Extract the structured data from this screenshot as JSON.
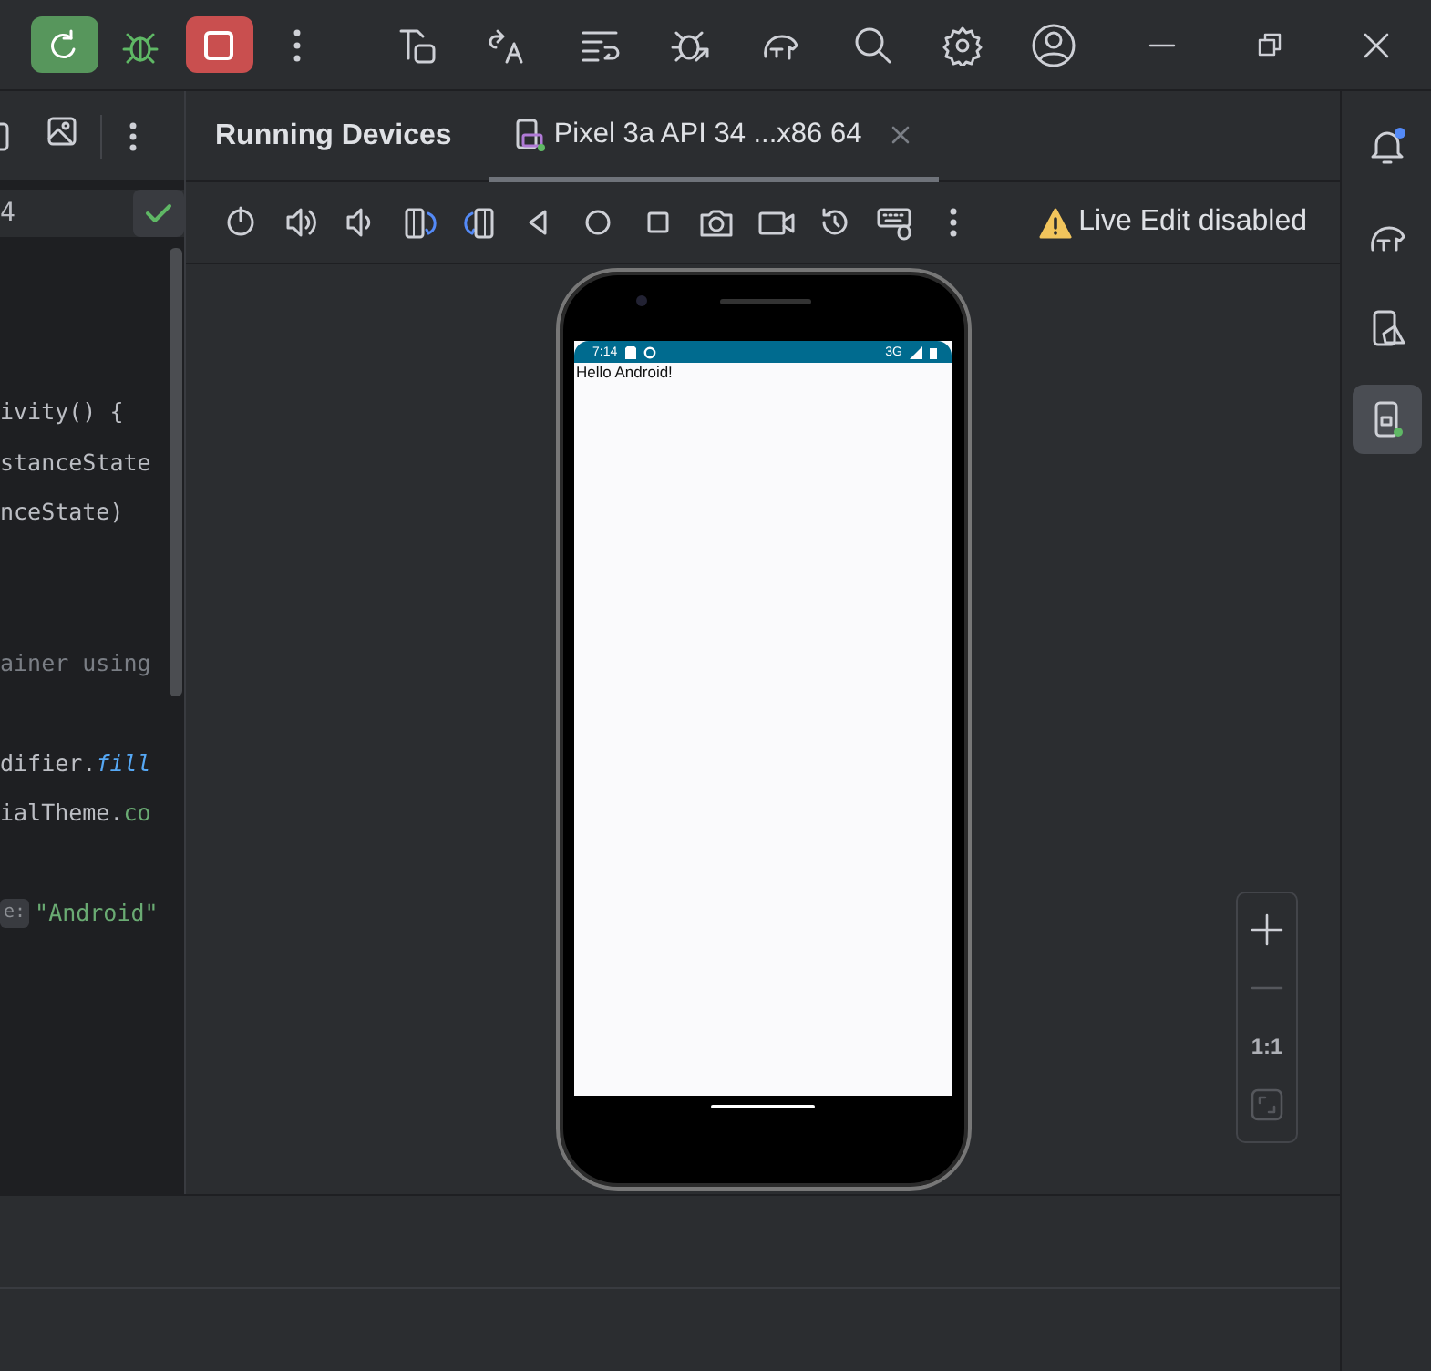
{
  "editor": {
    "gutter_text": "4",
    "lines": [
      {
        "kind": "code",
        "tokens": [
          {
            "kind": "plain",
            "text": "ivity() {"
          }
        ]
      },
      {
        "kind": "code",
        "tokens": [
          {
            "kind": "plain",
            "text": "stanceState"
          }
        ]
      },
      {
        "kind": "code",
        "tokens": [
          {
            "kind": "plain",
            "text": "nceState)"
          }
        ]
      },
      {
        "kind": "blank"
      },
      {
        "kind": "blank"
      },
      {
        "kind": "code",
        "tokens": [
          {
            "kind": "comment",
            "text": "ainer using"
          }
        ]
      },
      {
        "kind": "blank"
      },
      {
        "kind": "code",
        "tokens": [
          {
            "kind": "plain",
            "text": "difier."
          },
          {
            "kind": "call",
            "text": "fill"
          }
        ]
      },
      {
        "kind": "code",
        "tokens": [
          {
            "kind": "plain",
            "text": "ialTheme."
          },
          {
            "kind": "member",
            "text": "co"
          }
        ]
      },
      {
        "kind": "blank"
      },
      {
        "kind": "code",
        "tokens": [
          {
            "kind": "hint",
            "text": "e:"
          },
          {
            "kind": "string",
            "text": "\"Android\""
          }
        ]
      }
    ]
  },
  "panel": {
    "title": "Running Devices",
    "tabs": [
      {
        "label": "Pixel 3a API 34 ...x86 64",
        "selected": true
      }
    ],
    "live_edit": "Live Edit disabled"
  },
  "device": {
    "status_time": "7:14",
    "network": "3G",
    "screen_text": "Hello Android!"
  },
  "zoom_controls": [
    {
      "kind": "zoom-in",
      "disabled": false
    },
    {
      "kind": "zoom-out",
      "disabled": true
    },
    {
      "kind": "actual-size",
      "label": "1:1",
      "disabled": false
    },
    {
      "kind": "fit",
      "disabled": true
    }
  ],
  "sidebar": {
    "items": [
      {
        "kind": "notifications",
        "selected": false
      },
      {
        "kind": "gradle",
        "selected": false
      },
      {
        "kind": "device-manager",
        "selected": false
      },
      {
        "kind": "running-devices",
        "selected": true
      }
    ]
  }
}
